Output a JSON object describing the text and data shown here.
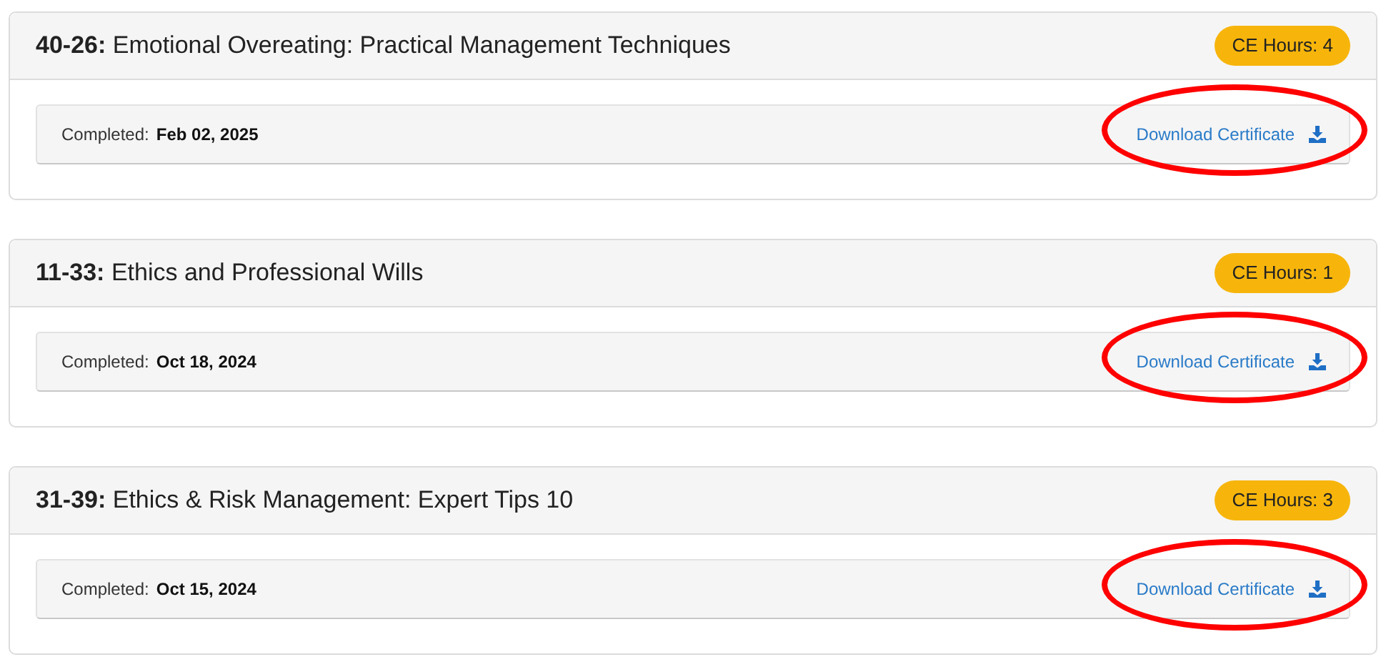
{
  "courses": [
    {
      "code": "40-26:",
      "title": "Emotional Overeating: Practical Management Techniques",
      "badge": "CE Hours: 4",
      "completed_label": "Completed:",
      "completed_date": "Feb 02, 2025",
      "link": "Download Certificate",
      "circled": true
    },
    {
      "code": "11-33:",
      "title": "Ethics and Professional Wills",
      "badge": "CE Hours: 1",
      "completed_label": "Completed:",
      "completed_date": "Oct 18, 2024",
      "link": "Download Certificate",
      "circled": true
    },
    {
      "code": "31-39:",
      "title": "Ethics & Risk Management: Expert Tips 10",
      "badge": "CE Hours: 3",
      "completed_label": "Completed:",
      "completed_date": "Oct 15, 2024",
      "link": "Download Certificate",
      "circled": true
    }
  ]
}
